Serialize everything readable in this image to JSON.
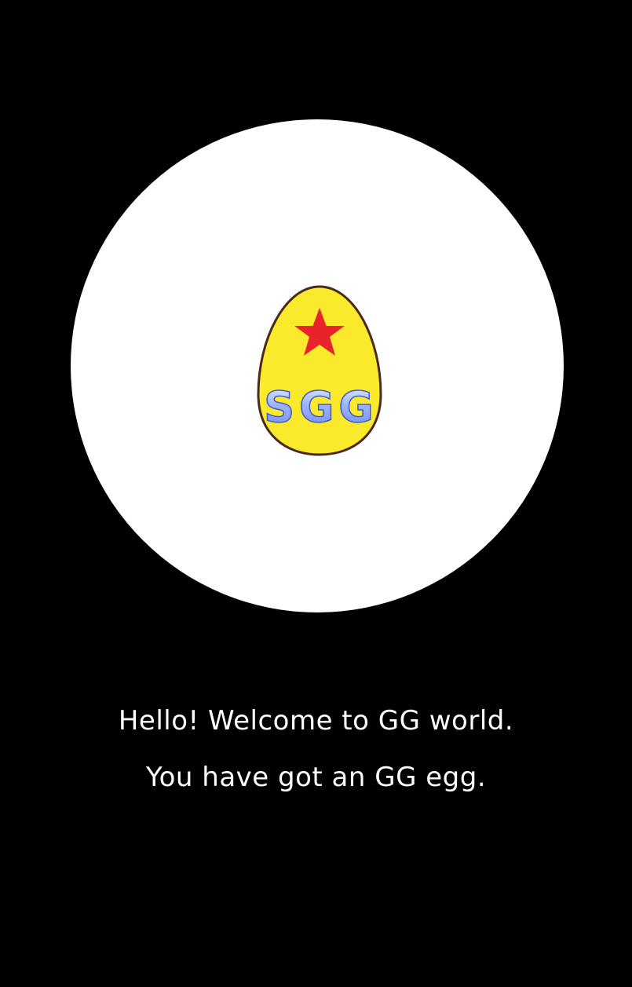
{
  "welcome": {
    "line1": "Hello! Welcome to GG world.",
    "line2": "You have got an GG egg."
  },
  "egg": {
    "label": "SGG",
    "star_color": "#e8232b",
    "shell_color": "#fbe92b",
    "outline_color": "#4a2a1a",
    "text_color": "#8ea8ff"
  },
  "colors": {
    "background": "#000000",
    "spotlight": "#ffffff",
    "text": "#ffffff"
  }
}
